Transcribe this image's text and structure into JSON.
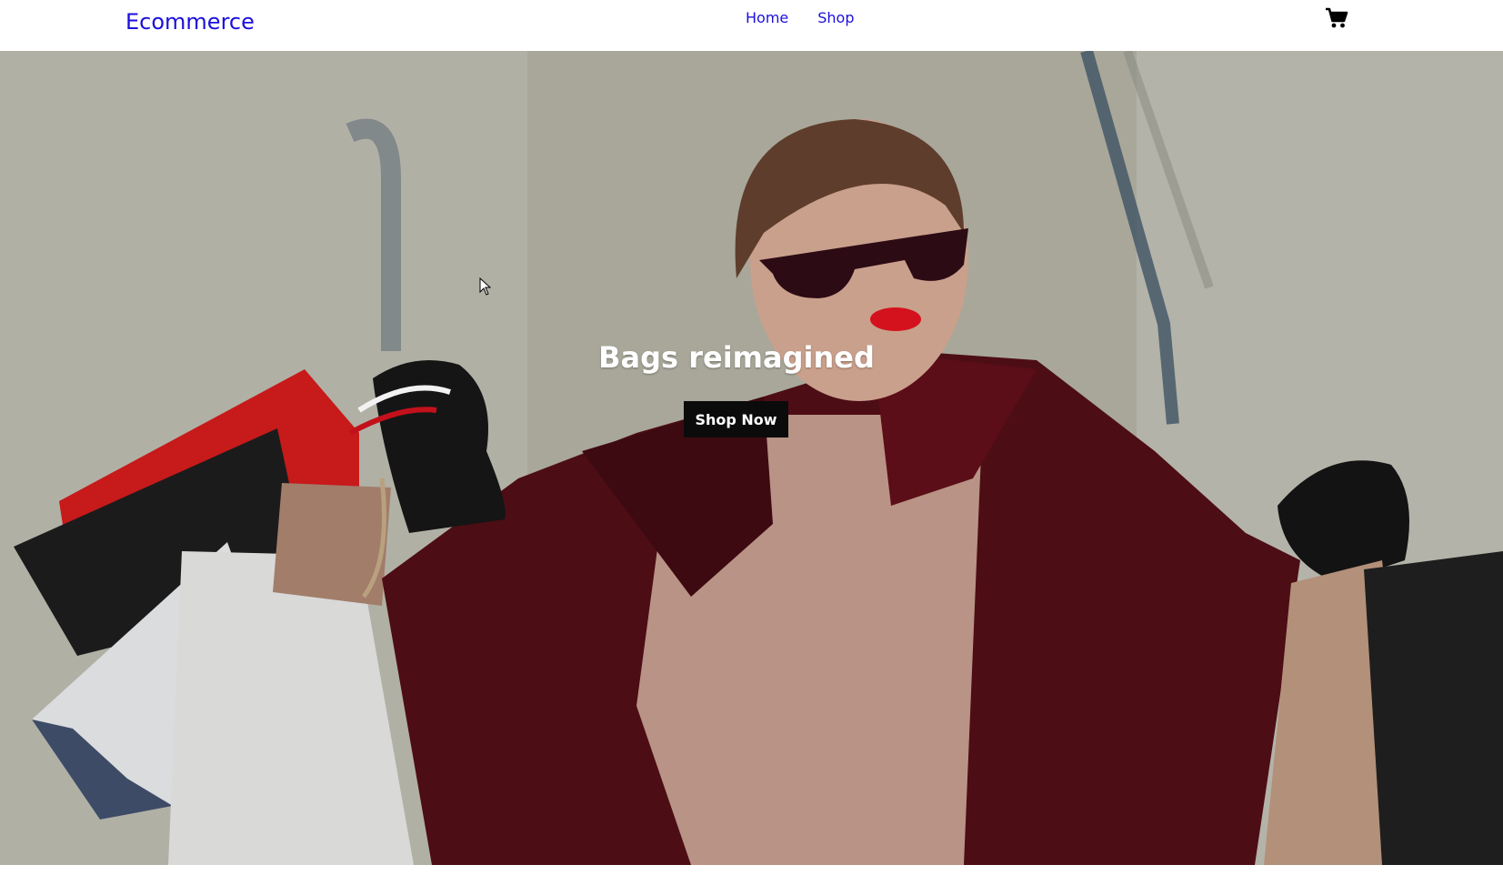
{
  "navbar": {
    "brand": "Ecommerce",
    "links": [
      {
        "label": "Home"
      },
      {
        "label": "Shop"
      }
    ],
    "cart_icon": "shopping-cart-icon"
  },
  "hero": {
    "title": "Bags reimagined",
    "button_label": "Shop Now"
  },
  "colors": {
    "brand": "#1b10dc",
    "button_bg": "#0c0b0b",
    "hero_bg": "#a9a89b",
    "coat": "#5a0f18"
  }
}
